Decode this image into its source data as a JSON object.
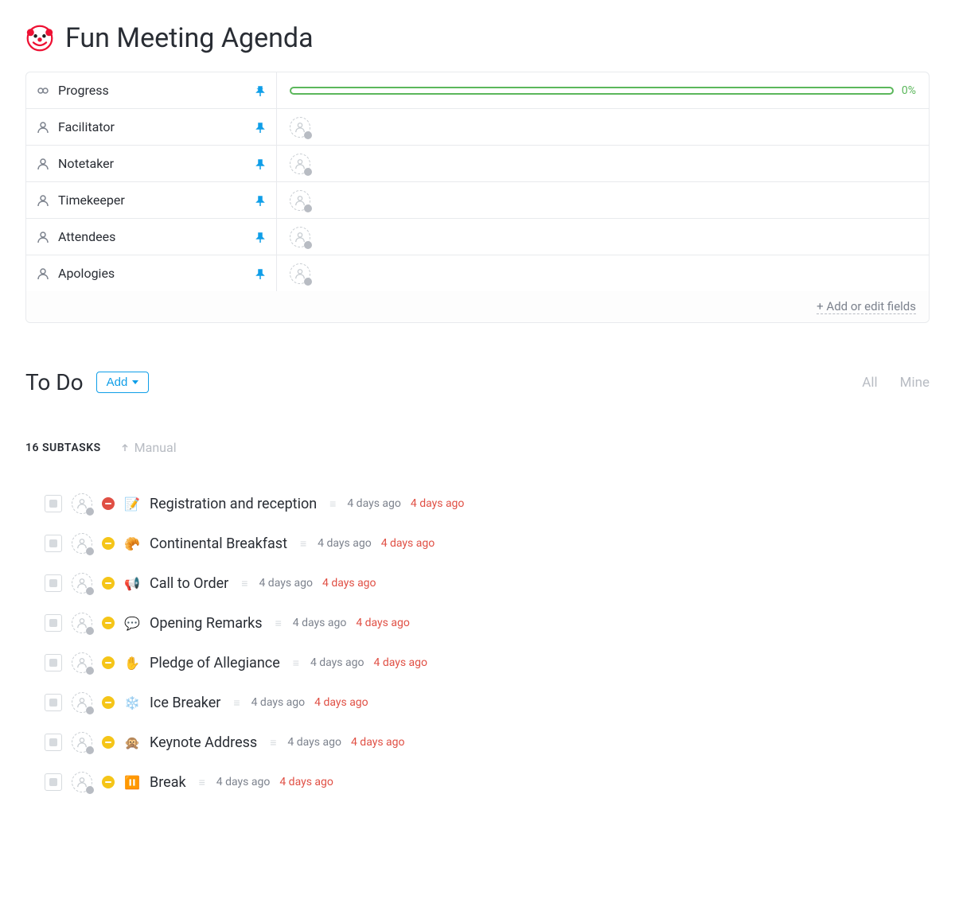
{
  "header": {
    "title": "Fun Meeting Agenda",
    "icon": "clown-icon"
  },
  "fields": [
    {
      "icon": "dashboard",
      "label": "Progress",
      "type": "progress",
      "value": 0,
      "display": "0%"
    },
    {
      "icon": "person",
      "label": "Facilitator",
      "type": "person"
    },
    {
      "icon": "person",
      "label": "Notetaker",
      "type": "person"
    },
    {
      "icon": "person",
      "label": "Timekeeper",
      "type": "person"
    },
    {
      "icon": "person",
      "label": "Attendees",
      "type": "person"
    },
    {
      "icon": "person",
      "label": "Apologies",
      "type": "person"
    }
  ],
  "fields_footer": "+ Add or edit fields",
  "todo": {
    "title": "To Do",
    "add_label": "Add",
    "filters": {
      "all": "All",
      "mine": "Mine"
    }
  },
  "subtasks": {
    "count": 16,
    "label": "16 SUBTASKS",
    "sort": "Manual"
  },
  "tasks": [
    {
      "priority": "red",
      "emoji": "📝",
      "name": "Registration and reception",
      "date1": "4 days ago",
      "date2": "4 days ago"
    },
    {
      "priority": "yellow",
      "emoji": "🥐",
      "name": "Continental Breakfast",
      "date1": "4 days ago",
      "date2": "4 days ago"
    },
    {
      "priority": "yellow",
      "emoji": "📢",
      "name": "Call to Order",
      "date1": "4 days ago",
      "date2": "4 days ago"
    },
    {
      "priority": "yellow",
      "emoji": "💬",
      "name": "Opening Remarks",
      "date1": "4 days ago",
      "date2": "4 days ago"
    },
    {
      "priority": "yellow",
      "emoji": "✋",
      "name": "Pledge of Allegiance",
      "date1": "4 days ago",
      "date2": "4 days ago"
    },
    {
      "priority": "yellow",
      "emoji": "❄️",
      "name": "Ice Breaker",
      "date1": "4 days ago",
      "date2": "4 days ago"
    },
    {
      "priority": "yellow",
      "emoji": "🙊",
      "name": "Keynote Address",
      "date1": "4 days ago",
      "date2": "4 days ago"
    },
    {
      "priority": "yellow",
      "emoji": "⏸️",
      "name": "Break",
      "date1": "4 days ago",
      "date2": "4 days ago"
    }
  ],
  "colors": {
    "accent": "#0f9ee8",
    "danger": "#e04f44",
    "warning": "#f5c518",
    "success": "#5bb75b"
  }
}
